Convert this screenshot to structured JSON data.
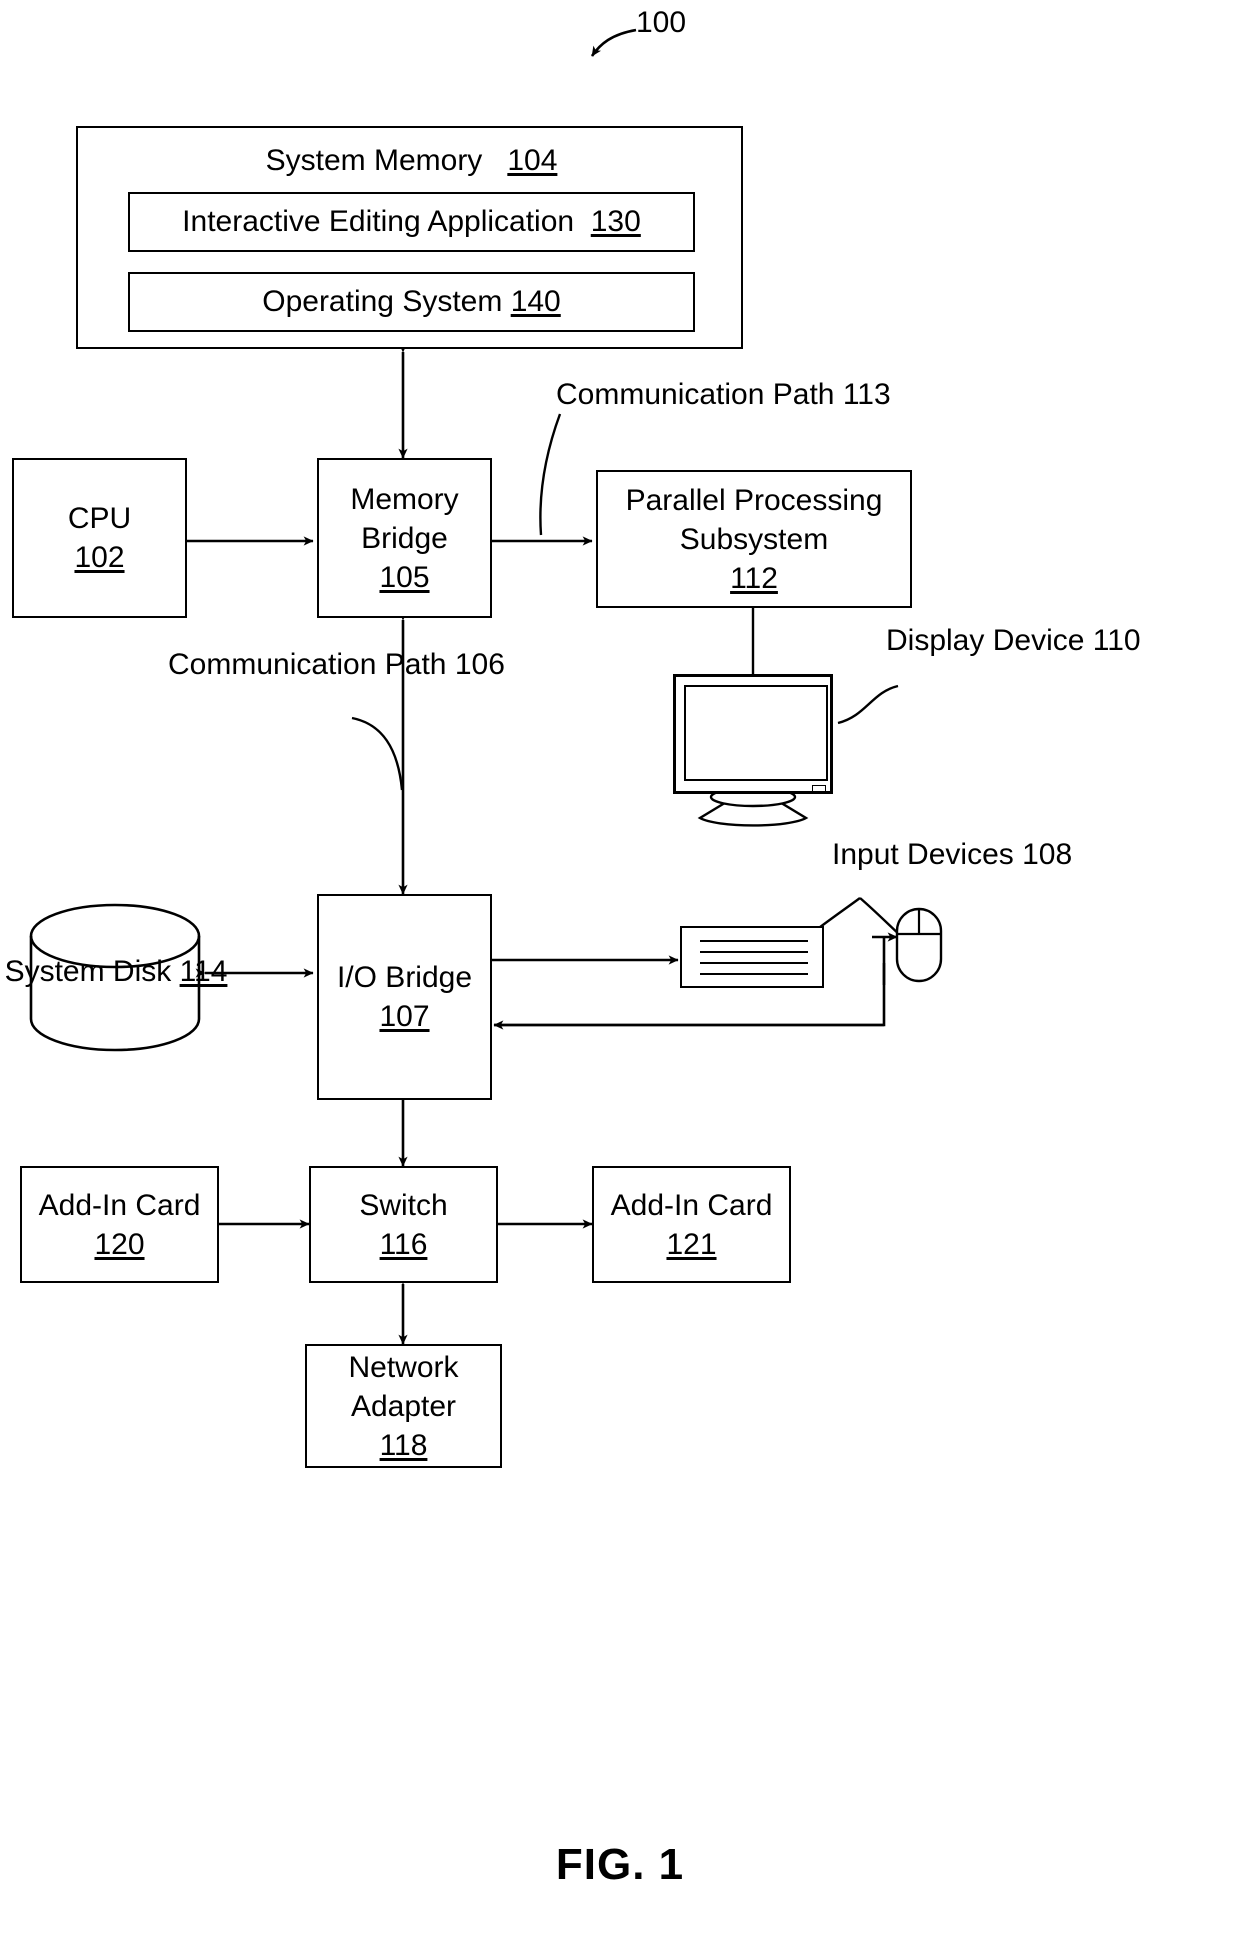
{
  "figure": {
    "caption": "FIG. 1",
    "system_ref": "100"
  },
  "blocks": {
    "system_memory": {
      "label": "System Memory",
      "ref": "104"
    },
    "interactive_editing_application": {
      "label": "Interactive Editing Application",
      "ref": "130"
    },
    "operating_system": {
      "label": "Operating System",
      "ref": "140"
    },
    "cpu": {
      "label": "CPU",
      "ref": "102"
    },
    "memory_bridge": {
      "label_line1": "Memory",
      "label_line2": "Bridge",
      "ref": "105"
    },
    "parallel_processing_subsystem": {
      "label_line1": "Parallel Processing",
      "label_line2": "Subsystem",
      "ref": "112"
    },
    "io_bridge": {
      "label": "I/O Bridge",
      "ref": "107"
    },
    "system_disk": {
      "label": "System Disk",
      "ref": "114"
    },
    "switch": {
      "label": "Switch",
      "ref": "116"
    },
    "add_in_card_120": {
      "label": "Add-In Card",
      "ref": "120"
    },
    "add_in_card_121": {
      "label": "Add-In Card",
      "ref": "121"
    },
    "network_adapter": {
      "label_line1": "Network",
      "label_line2": "Adapter",
      "ref": "118"
    }
  },
  "callouts": {
    "communication_path_113": {
      "line1": "Communication Path",
      "line2": "113"
    },
    "communication_path_106": {
      "line1": "Communication",
      "line2": "Path",
      "line3": "106"
    },
    "display_device": {
      "line1": "Display",
      "line2": "Device",
      "line3": "110"
    },
    "input_devices": {
      "line1": "Input Devices",
      "line2": "108"
    }
  },
  "colors": {
    "ink": "#000000",
    "paper": "#ffffff"
  }
}
